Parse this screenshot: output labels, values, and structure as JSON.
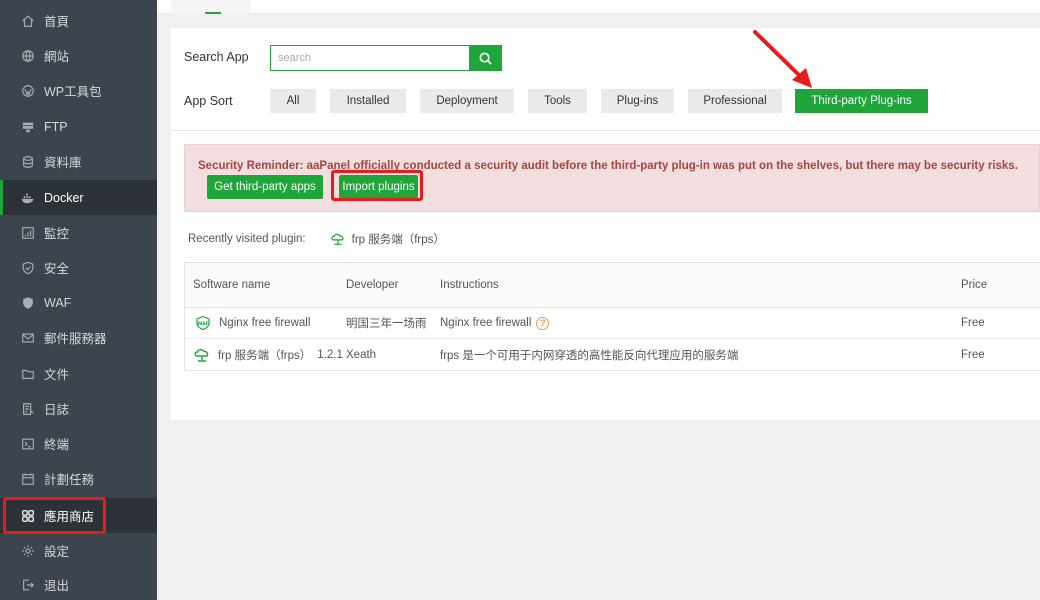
{
  "sidebar": {
    "items": [
      {
        "label": "首頁",
        "icon": "home-icon"
      },
      {
        "label": "網站",
        "icon": "globe-icon"
      },
      {
        "label": "WP工具包",
        "icon": "wordpress-icon"
      },
      {
        "label": "FTP",
        "icon": "ftp-icon"
      },
      {
        "label": "資料庫",
        "icon": "database-icon"
      },
      {
        "label": "Docker",
        "icon": "docker-icon"
      },
      {
        "label": "監控",
        "icon": "monitor-icon"
      },
      {
        "label": "安全",
        "icon": "shield-icon"
      },
      {
        "label": "WAF",
        "icon": "waf-shield-icon"
      },
      {
        "label": "郵件服務器",
        "icon": "mail-icon"
      },
      {
        "label": "文件",
        "icon": "folder-icon"
      },
      {
        "label": "日誌",
        "icon": "log-icon"
      },
      {
        "label": "終端",
        "icon": "terminal-icon"
      },
      {
        "label": "計劃任務",
        "icon": "calendar-icon"
      },
      {
        "label": "應用商店",
        "icon": "apps-grid-icon"
      },
      {
        "label": "設定",
        "icon": "gear-icon"
      },
      {
        "label": "退出",
        "icon": "logout-icon"
      }
    ]
  },
  "search": {
    "label": "Search App",
    "placeholder": "search"
  },
  "sort": {
    "label": "App Sort",
    "options": [
      "All",
      "Installed",
      "Deployment",
      "Tools",
      "Plug-ins",
      "Professional",
      "Third-party Plug-ins"
    ],
    "selected": "Third-party Plug-ins"
  },
  "reminder": {
    "text": "Security Reminder: aaPanel officially conducted a security audit before the third-party plug-in was put on the shelves, but there may be security risks.",
    "get_apps_label": "Get third-party apps",
    "import_label": "Import plugins"
  },
  "recent": {
    "label": "Recently visited plugin:",
    "item": "frp 服务端（frps）"
  },
  "table": {
    "headers": [
      "Software name",
      "Developer",
      "Instructions",
      "Price"
    ],
    "rows": [
      {
        "name": "Nginx free firewall",
        "version": "",
        "developer": "明国三年一场雨",
        "instructions": "Nginx free firewall",
        "price": "Free"
      },
      {
        "name": "frp 服务端（frps）",
        "version": "1.2.1",
        "developer": "Xeath",
        "instructions": "frps 是一个可用于内网穿透的高性能反向代理应用的服务端",
        "price": "Free"
      }
    ]
  },
  "colors": {
    "brand": "#20a53a",
    "sidebar": "#3c444d",
    "alert": "#a94442",
    "annotation": "#ea1b1b"
  }
}
